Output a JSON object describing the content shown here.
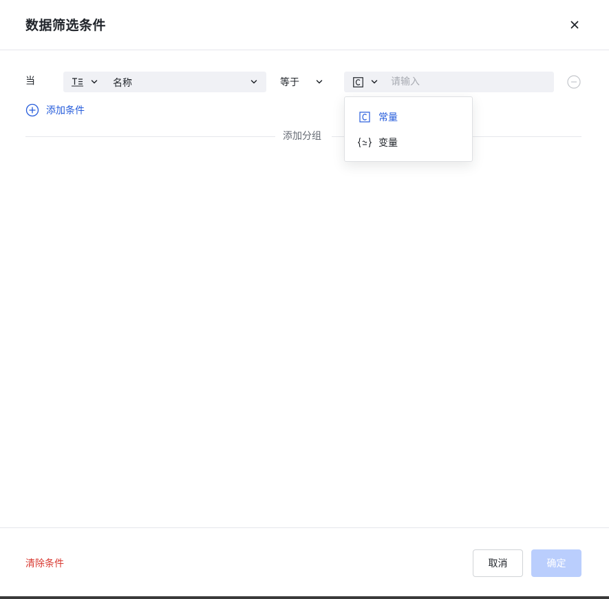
{
  "dialog": {
    "title": "数据筛选条件",
    "close_icon": "close-icon"
  },
  "condition": {
    "when_label": "当",
    "field": {
      "type_icon": "text-field-icon",
      "name": "名称"
    },
    "operator": {
      "label": "等于"
    },
    "value": {
      "type_icon": "constant-icon",
      "placeholder": "请输入",
      "current": ""
    },
    "remove_icon": "minus-circle-icon"
  },
  "add_condition": {
    "icon": "plus-circle-icon",
    "label": "添加条件"
  },
  "add_group": {
    "label": "添加分组"
  },
  "value_type_dropdown": {
    "items": [
      {
        "icon": "constant-icon",
        "label": "常量",
        "selected": true
      },
      {
        "icon": "variable-icon",
        "label": "变量",
        "selected": false
      }
    ]
  },
  "footer": {
    "clear_label": "清除条件",
    "cancel_label": "取消",
    "confirm_label": "确定"
  },
  "colors": {
    "accent": "#245bdb",
    "danger": "#d83931",
    "confirm_disabled_bg": "#bacefd",
    "field_bg": "#f0f1f5",
    "divider": "#e5e6eb"
  }
}
